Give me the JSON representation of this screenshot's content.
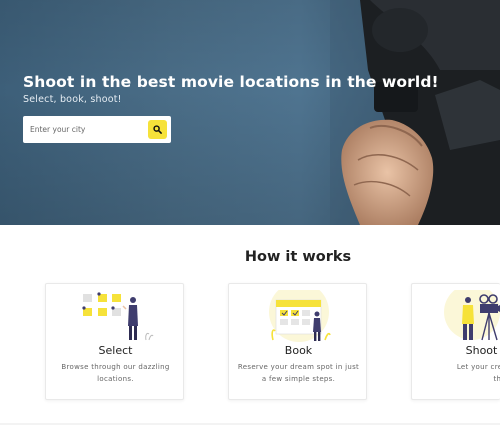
{
  "hero": {
    "title": "Shoot in the best movie locations in the world!",
    "subtitle": "Select, book, shoot!",
    "search": {
      "placeholder": "Enter your city"
    }
  },
  "how_it_works": {
    "title": "How it works",
    "cards": [
      {
        "title": "Select",
        "desc": "Browse through our dazzling locations.",
        "icon": "select-illustration"
      },
      {
        "title": "Book",
        "desc": "Reserve your dream spot in just a few simple steps.",
        "icon": "calendar-illustration"
      },
      {
        "title": "Shoot",
        "desc_line1": "Let your creative ge",
        "desc_line2": "the stage!",
        "icon": "film-camera-illustration"
      }
    ]
  },
  "colors": {
    "accent_yellow": "#f6e23a",
    "hero_blue": "#4a6d87",
    "illustration_purple": "#3f3d6e"
  },
  "icons": {
    "search_button": "search-icon"
  }
}
